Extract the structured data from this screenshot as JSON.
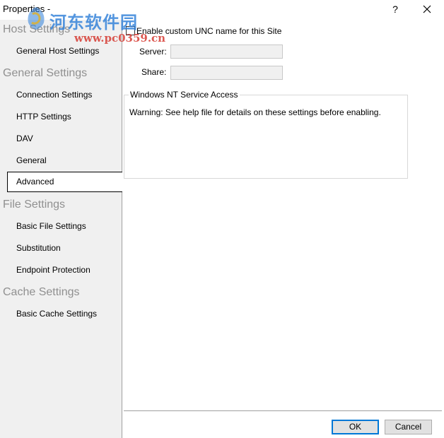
{
  "window": {
    "title": "Properties -",
    "help_label": "?"
  },
  "watermark": {
    "cn_text": "河东软件园",
    "url_text": "www.pc0359.cn"
  },
  "sidebar": {
    "groups": [
      {
        "header": "Host Settings",
        "items": [
          {
            "label": "General Host Settings"
          }
        ]
      },
      {
        "header": "General Settings",
        "items": [
          {
            "label": "Connection Settings"
          },
          {
            "label": "HTTP Settings"
          },
          {
            "label": "DAV"
          },
          {
            "label": "General"
          },
          {
            "label": "Advanced",
            "selected": true
          }
        ]
      },
      {
        "header": "File Settings",
        "items": [
          {
            "label": "Basic File Settings"
          },
          {
            "label": "Substitution"
          },
          {
            "label": "Endpoint Protection"
          }
        ]
      },
      {
        "header": "Cache Settings",
        "items": [
          {
            "label": "Basic Cache Settings"
          }
        ]
      }
    ]
  },
  "content": {
    "unc_checkbox": {
      "label": "Enable custom UNC name for this Site",
      "checked": false
    },
    "server": {
      "label": "Server:",
      "value": ""
    },
    "share": {
      "label": "Share:",
      "value": ""
    },
    "nt_service": {
      "title": "Windows NT Service Access",
      "warning": "Warning: See help file for details on these settings before enabling."
    }
  },
  "buttons": {
    "ok": "OK",
    "cancel": "Cancel"
  },
  "colors": {
    "accent": "#0078d7",
    "sidebar_bg": "#f0f0f0",
    "group_header": "#909090",
    "watermark_cn": "#2f7fd8",
    "watermark_url": "#d63c33"
  }
}
